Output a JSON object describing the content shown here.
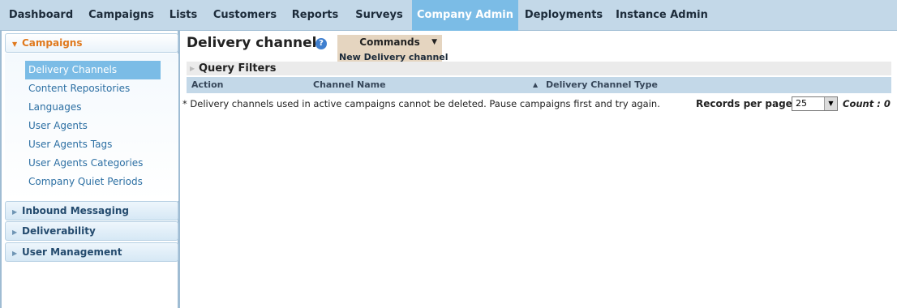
{
  "topnav": {
    "tabs": [
      {
        "label": "Dashboard",
        "active": false
      },
      {
        "label": "Campaigns",
        "active": false
      },
      {
        "label": "Lists",
        "active": false
      },
      {
        "label": "Customers",
        "active": false
      },
      {
        "label": "Reports",
        "active": false
      },
      {
        "label": "Surveys",
        "active": false
      },
      {
        "label": "Company Admin",
        "active": true
      },
      {
        "label": "Deployments",
        "active": false
      },
      {
        "label": "Instance Admin",
        "active": false
      }
    ]
  },
  "sidebar": {
    "sections": [
      {
        "label": "Campaigns",
        "expanded": true
      },
      {
        "label": "Inbound Messaging",
        "expanded": false
      },
      {
        "label": "Deliverability",
        "expanded": false
      },
      {
        "label": "User Management",
        "expanded": false
      }
    ],
    "items": [
      {
        "label": "Delivery Channels",
        "active": true
      },
      {
        "label": "Content Repositories",
        "active": false
      },
      {
        "label": "Languages",
        "active": false
      },
      {
        "label": "User Agents",
        "active": false
      },
      {
        "label": "User Agents Tags",
        "active": false
      },
      {
        "label": "User Agents Categories",
        "active": false
      },
      {
        "label": "Company Quiet Periods",
        "active": false
      }
    ]
  },
  "main": {
    "title": "Delivery channels",
    "help_icon": "?",
    "commands": {
      "label": "Commands",
      "arrow": "▼",
      "items": [
        "New Delivery channel"
      ]
    },
    "query_filters": "Query Filters",
    "table": {
      "columns": [
        "Action",
        "Channel Name",
        "Delivery Channel Type"
      ],
      "sort_indicator": "▲"
    },
    "note": "* Delivery channels used in active campaigns cannot be deleted. Pause campaigns first and try again.",
    "records_per_page_label": "Records per page",
    "records_per_page_value": "25",
    "count_text": "Count : 0"
  },
  "colors": {
    "nav_bg": "#c3d8e8",
    "active_tab": "#7bbce6",
    "section_open": "#e0791d",
    "link": "#2c6fa3",
    "commands_bg": "#e5d5c0"
  }
}
